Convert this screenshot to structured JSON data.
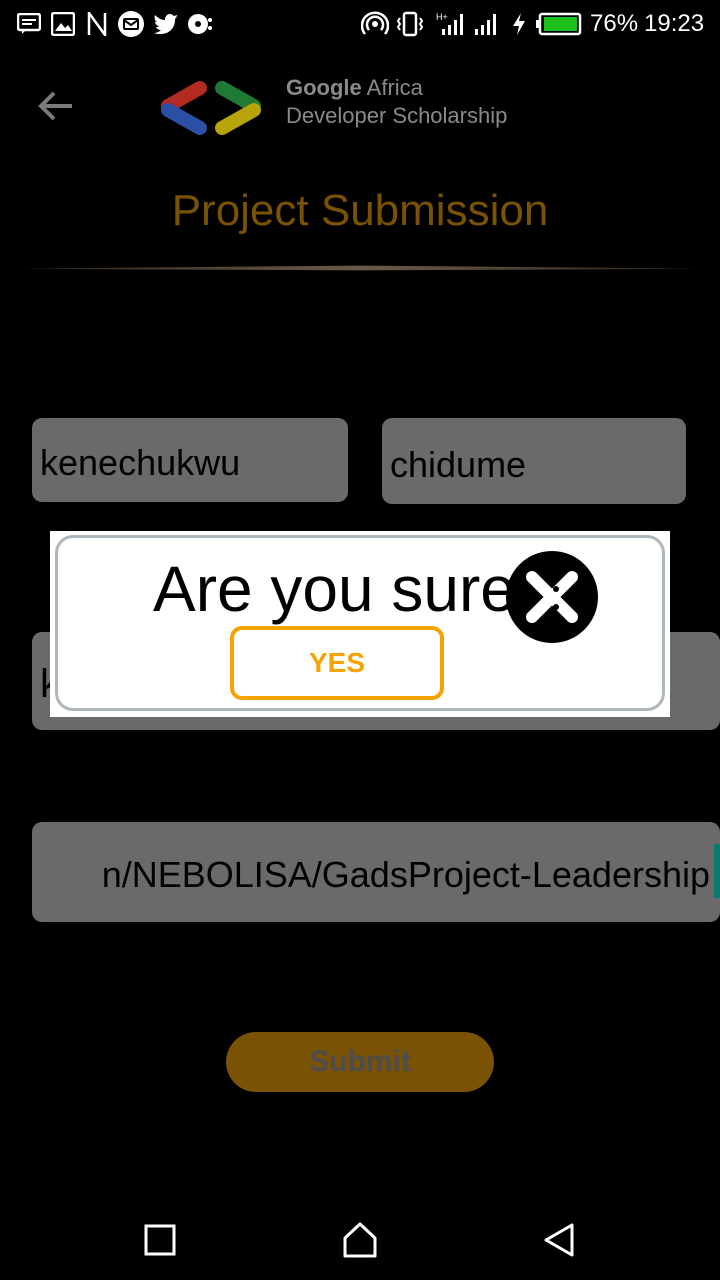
{
  "status_bar": {
    "battery_percent": "76%",
    "time": "19:23",
    "left_icons": [
      "message-icon",
      "image-icon",
      "n-icon",
      "mail-icon",
      "twitter-icon",
      "record-icon"
    ],
    "right_icons": [
      "hotspot-icon",
      "vibrate-icon",
      "signal-icon",
      "signal-icon",
      "charging-icon",
      "battery-icon"
    ]
  },
  "header": {
    "brand_line1_bold": "Google",
    "brand_line1_rest": " Africa",
    "brand_line2": "Developer Scholarship",
    "page_title": "Project Submission"
  },
  "form": {
    "first_name": "kenechukwu",
    "last_name": "chidume",
    "email_partial": "k",
    "project_link": "n/NEBOLISA/GadsProject-Leadership",
    "submit_label": "Submit"
  },
  "dialog": {
    "title": "Are you sure",
    "yes_label": "YES"
  },
  "colors": {
    "accent": "#f5a300",
    "title_color": "#7a5205",
    "field_bg": "#6a6a6a"
  }
}
